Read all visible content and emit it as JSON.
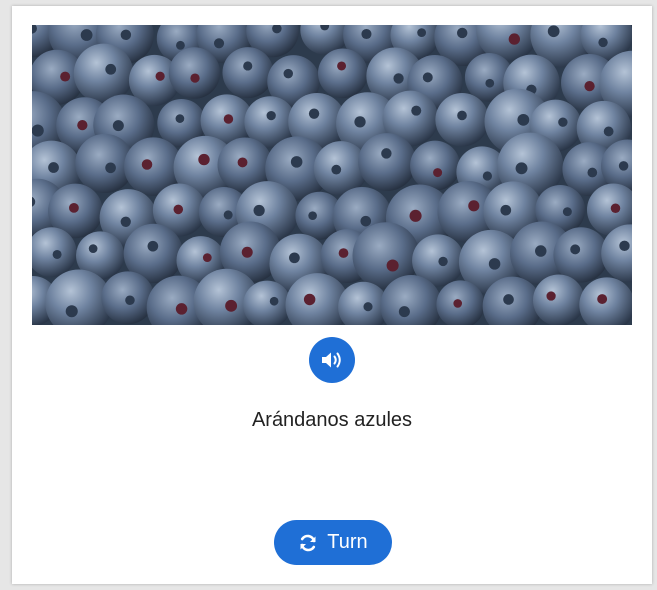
{
  "flashcard": {
    "image_subject": "blueberries",
    "word": "Arándanos azules",
    "audio_icon": "speaker-volume-icon",
    "turn_label": "Turn",
    "turn_icon": "sync-icon"
  },
  "colors": {
    "accent": "#1f6fd6",
    "card_bg": "#ffffff",
    "page_bg": "#e6e6e6",
    "text": "#222222"
  }
}
